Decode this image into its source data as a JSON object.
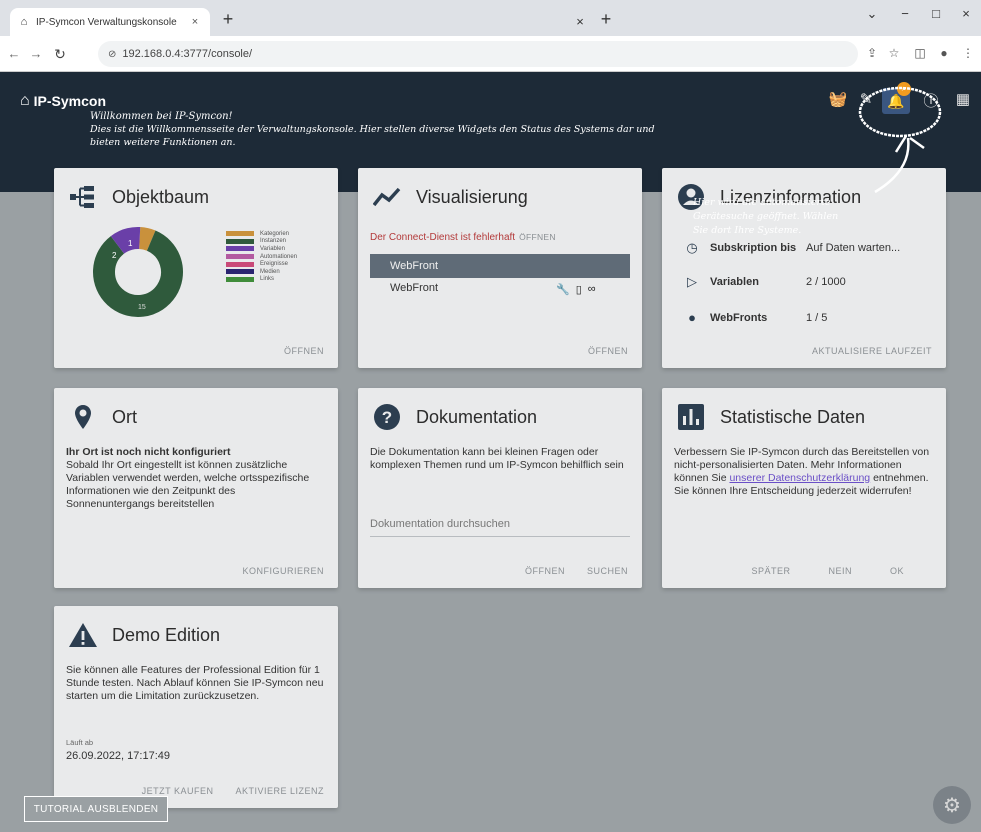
{
  "browser": {
    "tab_title": "IP-Symcon Verwaltungskonsole",
    "tab_close": "×",
    "new_tab": "+",
    "second_tab_close": "×",
    "url": "192.168.0.4:3777/console/",
    "win_min": "−",
    "win_max": "□",
    "win_close": "×",
    "win_chevron": "⌄"
  },
  "app": {
    "brand": "IP-Symcon",
    "welcome_title": "Willkommen bei IP-Symcon!",
    "welcome_line1": "Dies ist die Willkommensseite der Verwaltungskonsole. Hier stellen diverse Widgets den Status des Systems dar und",
    "welcome_line2": "bieten weitere Funktionen an.",
    "annotation_line1": "Hier wird die automatisierte",
    "annotation_line2": "Gerätesuche geöffnet. Wählen",
    "annotation_line3": "Sie dort Ihre Systeme."
  },
  "cards": {
    "objektbaum": {
      "title": "Objektbaum",
      "action": "ÖFFNEN",
      "donut": [
        {
          "label": "Kategorien",
          "value": 1,
          "color": "#c9913c"
        },
        {
          "label": "Instanzen",
          "value": 15,
          "color": "#2f5a3c"
        },
        {
          "label": "Variablen",
          "value": 2,
          "color": "#6a3fa8"
        },
        {
          "label": "Automationen",
          "value": 0,
          "color": "#b35aa0"
        },
        {
          "label": "Ereignisse",
          "value": 0,
          "color": "#c94a78"
        },
        {
          "label": "Medien",
          "value": 0,
          "color": "#2a2470"
        },
        {
          "label": "Links",
          "value": 0,
          "color": "#3f8c3a"
        }
      ],
      "donut_labels": {
        "a": "2",
        "b": "1",
        "c": "15"
      }
    },
    "visualisierung": {
      "title": "Visualisierung",
      "error": "Der Connect-Dienst ist fehlerhaft",
      "error_action": "ÖFFNEN",
      "row1": "WebFront",
      "row2": "WebFront",
      "action": "ÖFFNEN"
    },
    "lizenz": {
      "title": "Lizenzinformation",
      "rows": [
        {
          "key": "Subskription bis",
          "value": "Auf Daten warten..."
        },
        {
          "key": "Variablen",
          "value": "2 / 1000"
        },
        {
          "key": "WebFronts",
          "value": "1 / 5"
        }
      ],
      "action": "AKTUALISIERE LAUFZEIT"
    },
    "ort": {
      "title": "Ort",
      "bold": "Ihr Ort ist noch nicht konfiguriert",
      "text": "Sobald Ihr Ort eingestellt ist können zusätzliche Variablen verwendet werden, welche ortsspezifische Informationen wie den Zeitpunkt des Sonnenuntergangs bereitstellen",
      "action": "KONFIGURIEREN"
    },
    "doku": {
      "title": "Dokumentation",
      "text": "Die Dokumentation kann bei kleinen Fragen oder komplexen Themen rund um IP-Symcon behilflich sein",
      "search_placeholder": "Dokumentation durchsuchen",
      "action1": "ÖFFNEN",
      "action2": "SUCHEN"
    },
    "statistik": {
      "title": "Statistische Daten",
      "text1": "Verbessern Sie IP-Symcon durch das Bereitstellen von nicht-personalisierten Daten. Mehr Informationen können Sie",
      "link": "unserer Datenschutzerklärung",
      "text2": "entnehmen. Sie können Ihre Entscheidung jederzeit widerrufen!",
      "action1": "SPÄTER",
      "action2": "NEIN",
      "action3": "OK"
    },
    "demo": {
      "title": "Demo Edition",
      "text": "Sie können alle Features der Professional Edition für 1 Stunde testen. Nach Ablauf können Sie IP-Symcon neu starten um die Limitation zurückzusetzen.",
      "meta": "Läuft ab",
      "date": "26.09.2022, 17:17:49",
      "action1": "JETZT KAUFEN",
      "action2": "AKTIVIERE LIZENZ"
    }
  },
  "tutorial_button": "TUTORIAL AUSBLENDEN",
  "colors": {
    "header": "#1d2a37",
    "background": "#9aa0a3",
    "card": "#e9eaeb",
    "accent_bell": "#3a5680"
  }
}
